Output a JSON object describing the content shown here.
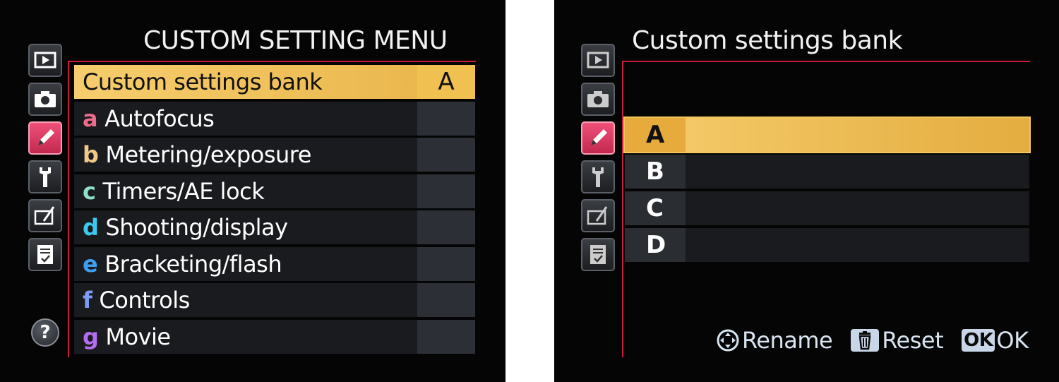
{
  "left_screen": {
    "title": "CUSTOM SETTING MENU",
    "tabs": [
      {
        "icon": "playback-icon",
        "active": false
      },
      {
        "icon": "camera-icon",
        "active": false
      },
      {
        "icon": "pencil-icon",
        "active": true
      },
      {
        "icon": "wrench-icon",
        "active": false
      },
      {
        "icon": "retouch-icon",
        "active": false
      },
      {
        "icon": "my-menu-icon",
        "active": false
      }
    ],
    "help": "?",
    "items": [
      {
        "letter": "",
        "label": "Custom settings bank",
        "value": "A",
        "selected": true,
        "letter_color": ""
      },
      {
        "letter": "a",
        "label": "Autofocus",
        "value": "",
        "selected": false,
        "letter_color": "#f06a8c"
      },
      {
        "letter": "b",
        "label": "Metering/exposure",
        "value": "",
        "selected": false,
        "letter_color": "#f0c98a"
      },
      {
        "letter": "c",
        "label": "Timers/AE lock",
        "value": "",
        "selected": false,
        "letter_color": "#8fe0c8"
      },
      {
        "letter": "d",
        "label": "Shooting/display",
        "value": "",
        "selected": false,
        "letter_color": "#3cc8f0"
      },
      {
        "letter": "e",
        "label": "Bracketing/flash",
        "value": "",
        "selected": false,
        "letter_color": "#3ca0f0"
      },
      {
        "letter": "f",
        "label": "Controls",
        "value": "",
        "selected": false,
        "letter_color": "#7c9cf5"
      },
      {
        "letter": "g",
        "label": "Movie",
        "value": "",
        "selected": false,
        "letter_color": "#b46cf0"
      }
    ]
  },
  "right_screen": {
    "title": "Custom settings bank",
    "tabs": [
      {
        "icon": "playback-icon",
        "active": false
      },
      {
        "icon": "camera-icon",
        "active": false
      },
      {
        "icon": "pencil-icon",
        "active": true
      },
      {
        "icon": "wrench-icon",
        "active": false
      },
      {
        "icon": "retouch-icon",
        "active": false
      },
      {
        "icon": "my-menu-icon",
        "active": false
      }
    ],
    "banks": [
      {
        "label": "A",
        "selected": true
      },
      {
        "label": "B",
        "selected": false
      },
      {
        "label": "C",
        "selected": false
      },
      {
        "label": "D",
        "selected": false
      }
    ],
    "footer": {
      "rename_label": "Rename",
      "reset_label": "Reset",
      "ok_badge": "OK",
      "ok_label": "OK"
    }
  },
  "colors": {
    "selection": "#f0c050",
    "frame": "#c81e3c",
    "active_tab": "#e0406a"
  }
}
